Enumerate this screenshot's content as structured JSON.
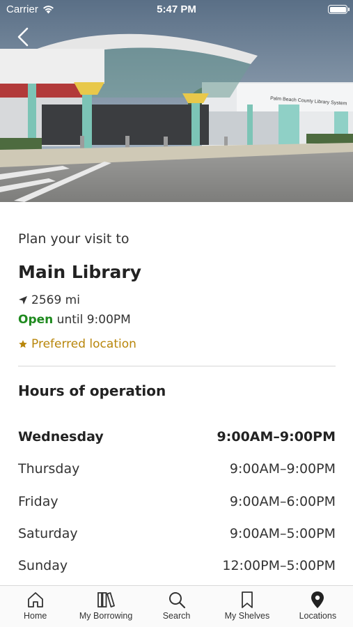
{
  "status_bar": {
    "carrier": "Carrier",
    "time": "5:47 PM"
  },
  "hero": {
    "sign_text": "Palm Beach County Library System",
    "icon": "back-chevron-icon"
  },
  "location": {
    "eyebrow": "Plan your visit to",
    "name": "Main Library",
    "distance": "2569 mi",
    "open_status": "Open",
    "open_until": "until 9:00PM",
    "preferred_label": "Preferred location"
  },
  "hours": {
    "heading": "Hours of operation",
    "rows": [
      {
        "day": "Wednesday",
        "time": "9:00AM–9:00PM"
      },
      {
        "day": "Thursday",
        "time": "9:00AM–9:00PM"
      },
      {
        "day": "Friday",
        "time": "9:00AM–6:00PM"
      },
      {
        "day": "Saturday",
        "time": "9:00AM–5:00PM"
      },
      {
        "day": "Sunday",
        "time": "12:00PM–5:00PM"
      }
    ]
  },
  "tabs": [
    {
      "label": "Home",
      "icon": "home-icon"
    },
    {
      "label": "My Borrowing",
      "icon": "books-icon"
    },
    {
      "label": "Search",
      "icon": "search-icon"
    },
    {
      "label": "My Shelves",
      "icon": "bookmark-icon"
    },
    {
      "label": "Locations",
      "icon": "location-pin-icon"
    }
  ],
  "colors": {
    "open": "#1f8a1f",
    "preferred": "#b8860b",
    "text": "#2b2b2b"
  }
}
